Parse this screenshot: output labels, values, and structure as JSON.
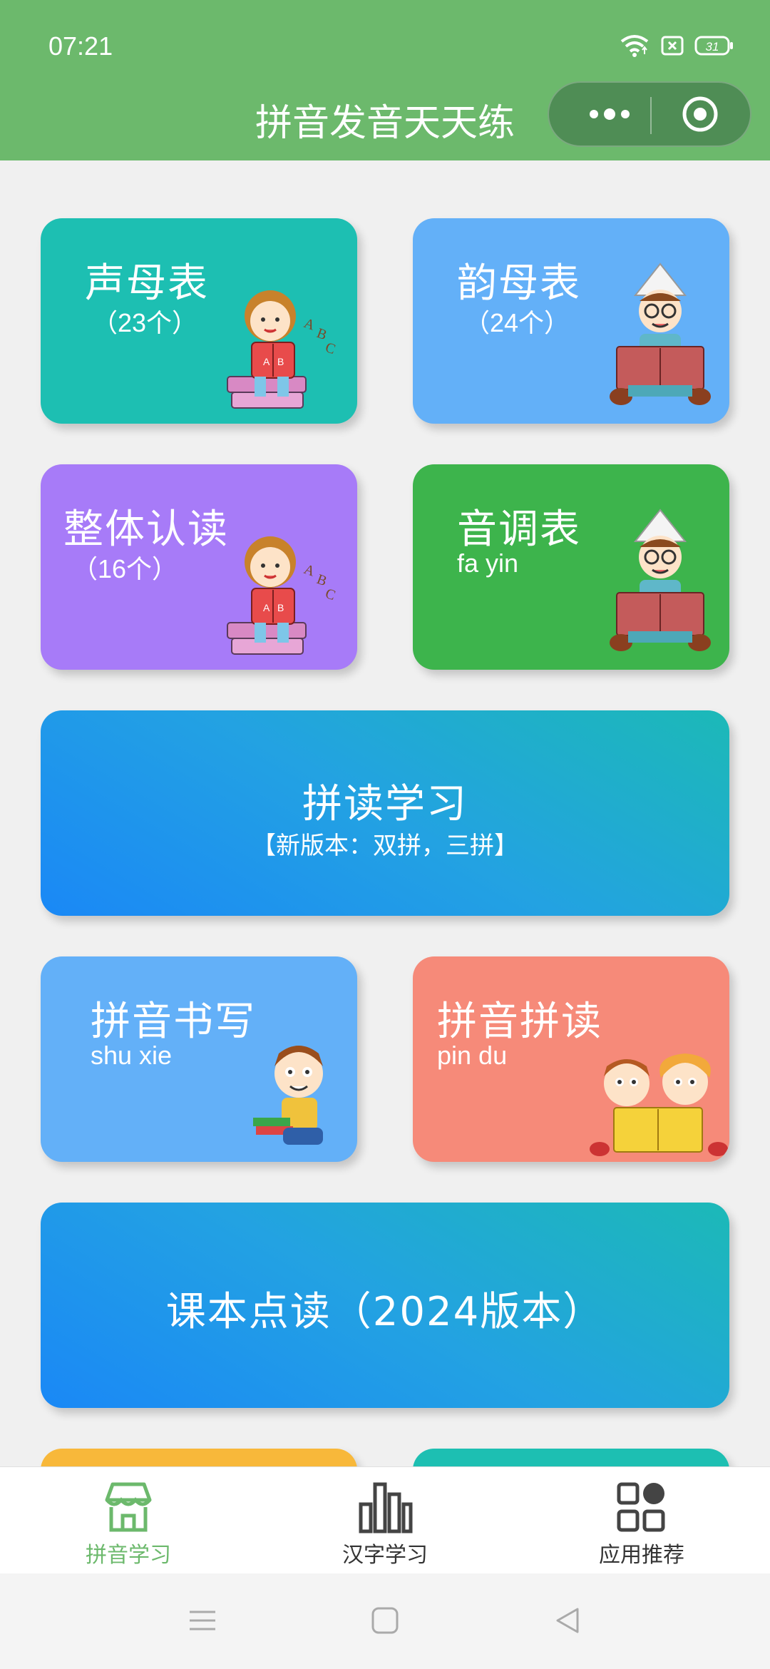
{
  "status_bar": {
    "time": "07:21",
    "battery": "31"
  },
  "header": {
    "title": "拼音发音天天练"
  },
  "cards": {
    "shengmu": {
      "title": "声母表",
      "subtitle": "（23个）"
    },
    "yunmu": {
      "title": "韵母表",
      "subtitle": "（24个）"
    },
    "zhengti": {
      "title": "整体认读",
      "subtitle": "（16个）"
    },
    "yindiao": {
      "title": "音调表",
      "subtitle": "fa yin"
    },
    "pindu_study": {
      "title": "拼读学习",
      "subtitle": "【新版本：双拼，三拼】"
    },
    "shuxie": {
      "title": "拼音书写",
      "subtitle": "shu xie"
    },
    "pindu": {
      "title": "拼音拼读",
      "subtitle": "pin du"
    },
    "textbook": {
      "title": "课本点读（2024版本）"
    }
  },
  "tabbar": {
    "tabs": [
      {
        "label": "拼音学习"
      },
      {
        "label": "汉字学习"
      },
      {
        "label": "应用推荐"
      }
    ],
    "active_color": "#6cb96c"
  },
  "colors": {
    "header": "#6cb96c",
    "teal": "#1dbfb2",
    "sky": "#63b0f8",
    "purple": "#a77bf8",
    "green": "#3db44c",
    "salmon": "#f68a79"
  }
}
